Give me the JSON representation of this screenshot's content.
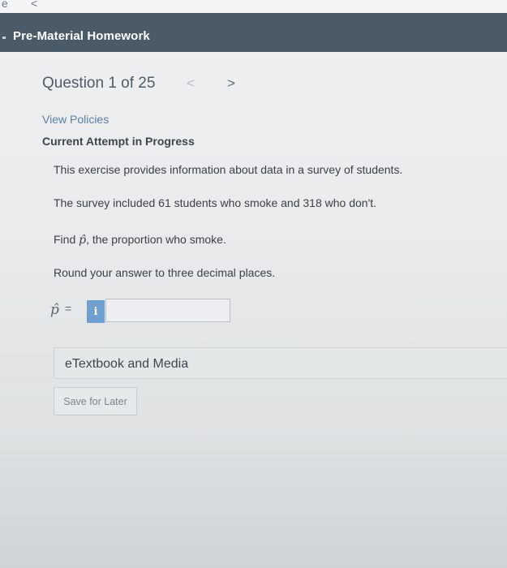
{
  "browser": {
    "glyph_left": "e",
    "glyph_mid": "<"
  },
  "header": {
    "title": "Pre-Material Homework"
  },
  "question_nav": {
    "label": "Question 1 of 25",
    "prev": "<",
    "next": ">"
  },
  "links": {
    "view_policies": "View Policies"
  },
  "status": {
    "attempt": "Current Attempt in Progress"
  },
  "question": {
    "intro": "This exercise provides information about data in a survey of students.",
    "data": "The survey included 61 students who smoke and 318 who don't.",
    "task_prefix": "Find ",
    "task_symbol": "p̂",
    "task_suffix": ", the proportion who smoke.",
    "rounding": "Round your answer to three decimal places."
  },
  "answer": {
    "symbol": "p̂",
    "equals": "=",
    "info_label": "i",
    "value": "",
    "placeholder": ""
  },
  "resources": {
    "etextbook": "eTextbook and Media"
  },
  "actions": {
    "save_for_later": "Save for Later"
  }
}
